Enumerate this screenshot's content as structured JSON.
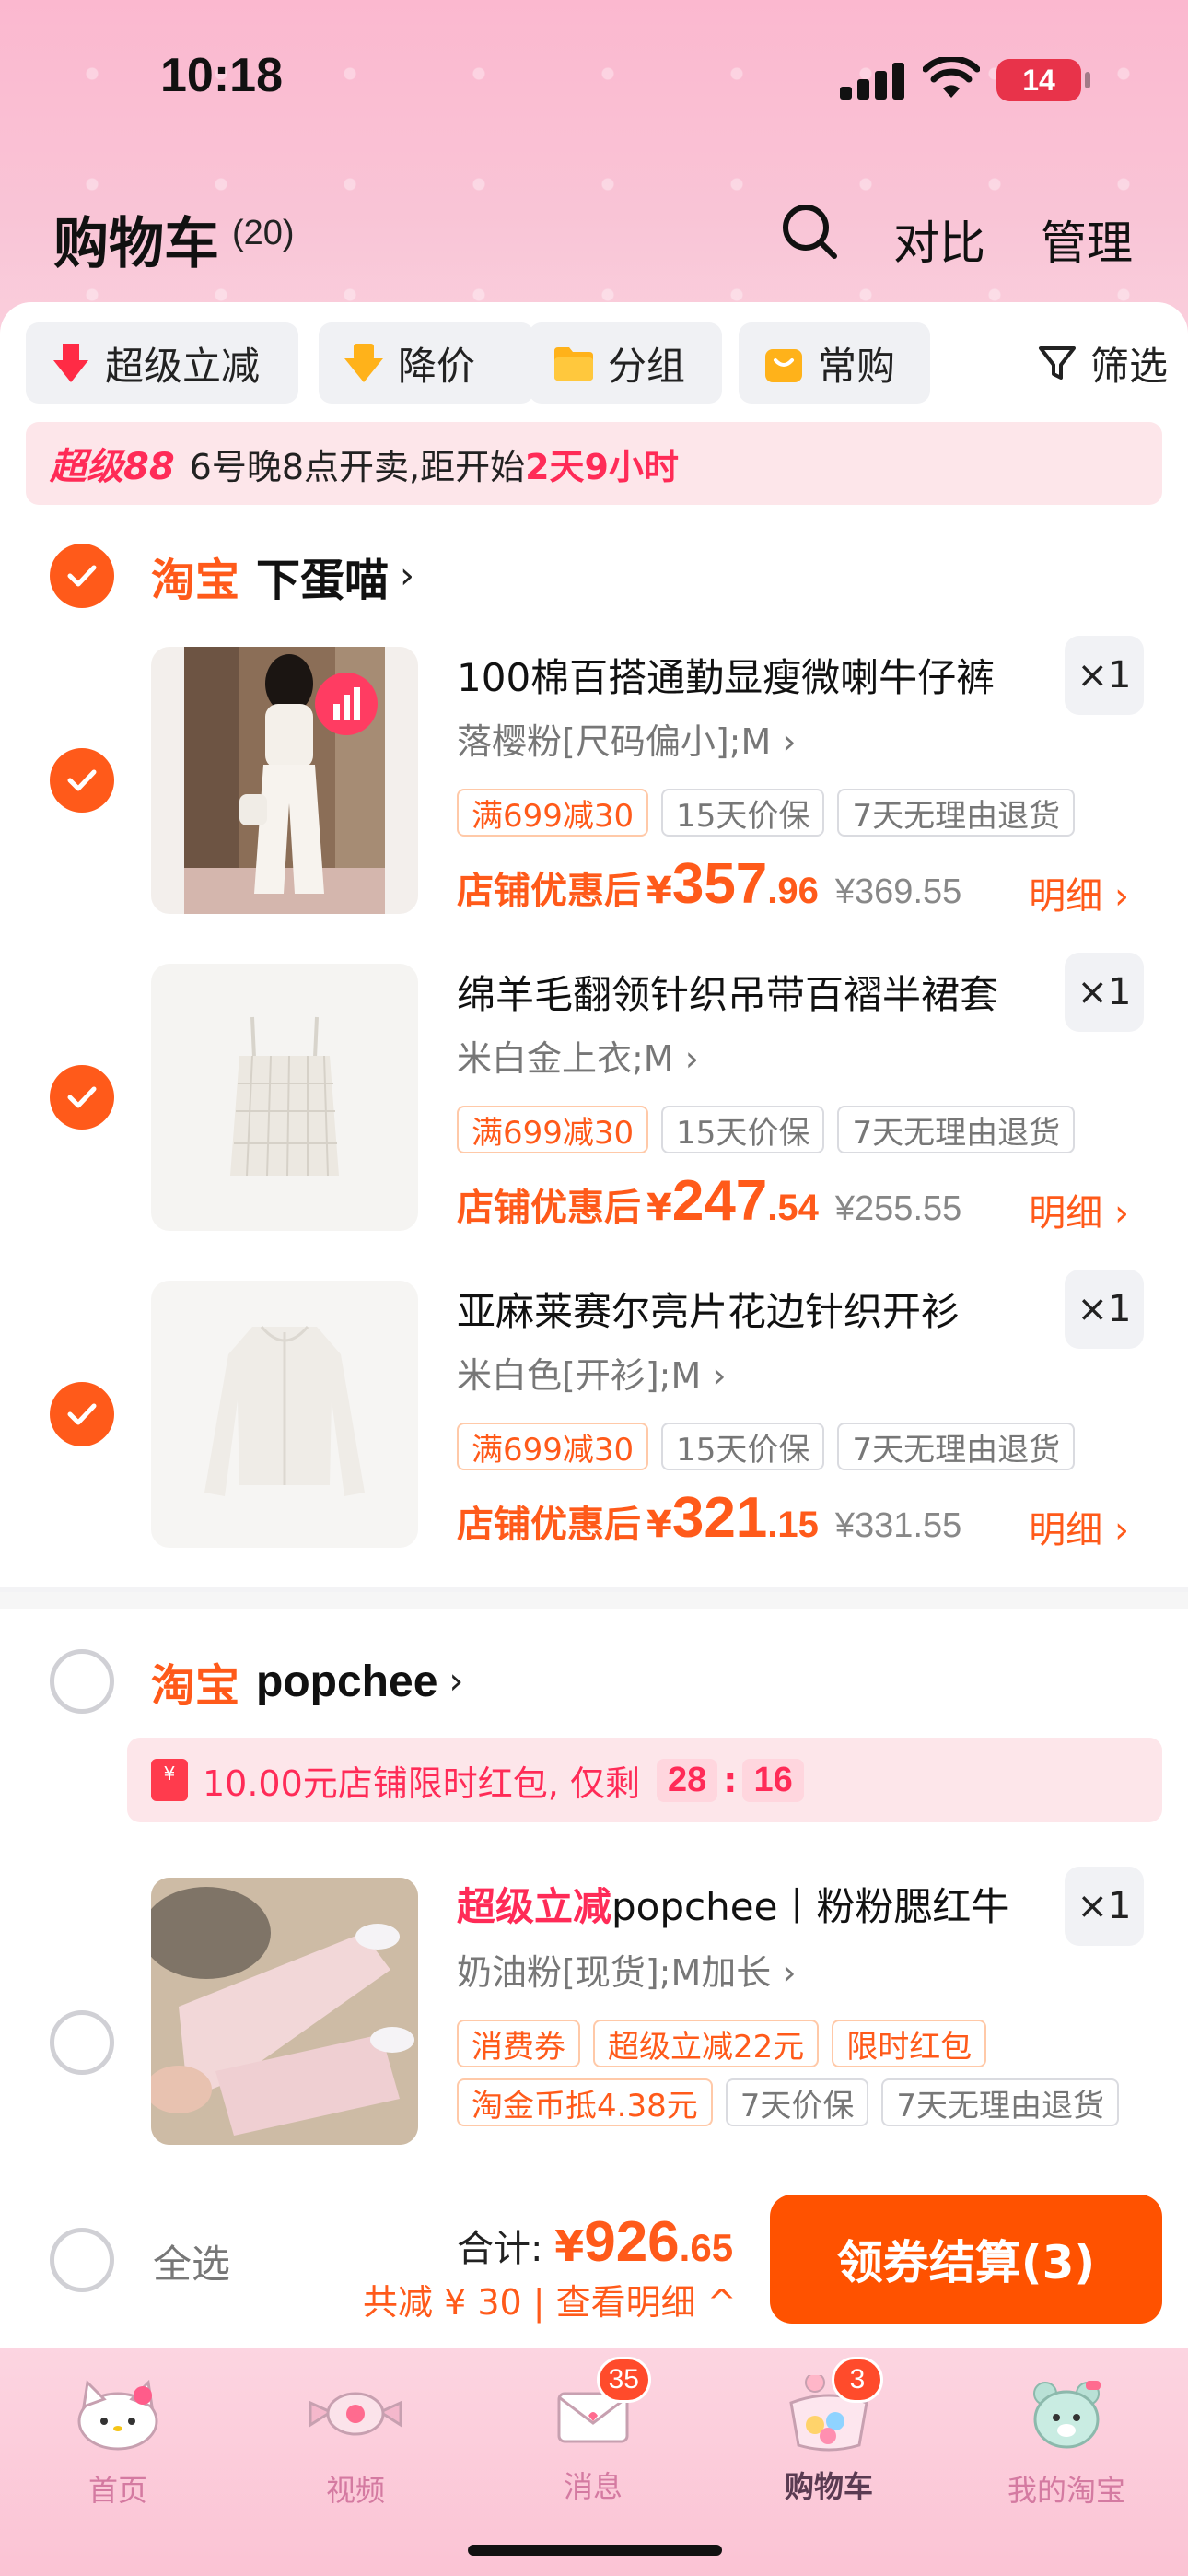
{
  "status_bar": {
    "time": "10:18",
    "battery": "14"
  },
  "header": {
    "title": "购物车",
    "count": "(20)",
    "compare": "对比",
    "manage": "管理"
  },
  "filters": [
    {
      "label": "超级立减",
      "icon": "arrow-down-red-icon"
    },
    {
      "label": "降价",
      "icon": "price-drop-icon"
    },
    {
      "label": "分组",
      "icon": "folder-icon"
    },
    {
      "label": "常购",
      "icon": "bag-icon"
    }
  ],
  "filter_label": "筛选",
  "promo_banner": {
    "tag": "超级88",
    "text": "6号晚8点开卖,距开始",
    "countdown": "2天9小时"
  },
  "store1": {
    "platform": "淘宝",
    "name": "下蛋喵",
    "items": [
      {
        "name": "100棉百搭通勤显瘦微喇牛仔裤",
        "sku": "落樱粉[尺码偏小];M",
        "qty": "×1",
        "tags": [
          "满699减30",
          "15天价保",
          "7天无理由退货"
        ],
        "price_label": "店铺优惠后",
        "price_int": "357",
        "price_dec": ".96",
        "orig": "¥369.55",
        "detail": "明细"
      },
      {
        "name": "绵羊毛翻领针织吊带百褶半裙套",
        "sku": "米白金上衣;M",
        "qty": "×1",
        "tags": [
          "满699减30",
          "15天价保",
          "7天无理由退货"
        ],
        "price_label": "店铺优惠后",
        "price_int": "247",
        "price_dec": ".54",
        "orig": "¥255.55",
        "detail": "明细"
      },
      {
        "name": "亚麻莱赛尔亮片花边针织开衫",
        "sku": "米白色[开衫];M",
        "qty": "×1",
        "tags": [
          "满699减30",
          "15天价保",
          "7天无理由退货"
        ],
        "price_label": "店铺优惠后",
        "price_int": "321",
        "price_dec": ".15",
        "orig": "¥331.55",
        "detail": "明细"
      }
    ]
  },
  "store2": {
    "platform": "淘宝",
    "name": "popchee",
    "hongbao": {
      "text": "10.00元店铺限时红包, 仅剩",
      "min": "28",
      "sec": "16"
    },
    "item": {
      "tag": "超级立减",
      "name": "popchee丨粉粉腮红牛",
      "sku": "奶油粉[现货];M加长",
      "qty": "×1",
      "tags_row1": [
        "消费券",
        "超级立减22元",
        "限时红包"
      ],
      "tags_row2": [
        "淘金币抵4.38元",
        "7天价保",
        "7天无理由退货"
      ]
    }
  },
  "checkout": {
    "select_all": "全选",
    "total_label": "合计:",
    "yen": "¥",
    "total_int": "926",
    "total_dec": ".65",
    "saved": "共减 ¥ 30 | 查看明细 ^",
    "button": "领券结算(3)"
  },
  "tabs": [
    {
      "label": "首页",
      "icon": "hello-kitty-icon"
    },
    {
      "label": "视频",
      "icon": "candy-icon"
    },
    {
      "label": "消息",
      "icon": "envelope-icon",
      "badge": "35"
    },
    {
      "label": "购物车",
      "icon": "cart-basket-icon",
      "badge": "3"
    },
    {
      "label": "我的淘宝",
      "icon": "bear-icon"
    }
  ],
  "colors": {
    "accent": "#ff5a1a",
    "pink_bg": "#fbb8cf",
    "red": "#ff2b57"
  }
}
